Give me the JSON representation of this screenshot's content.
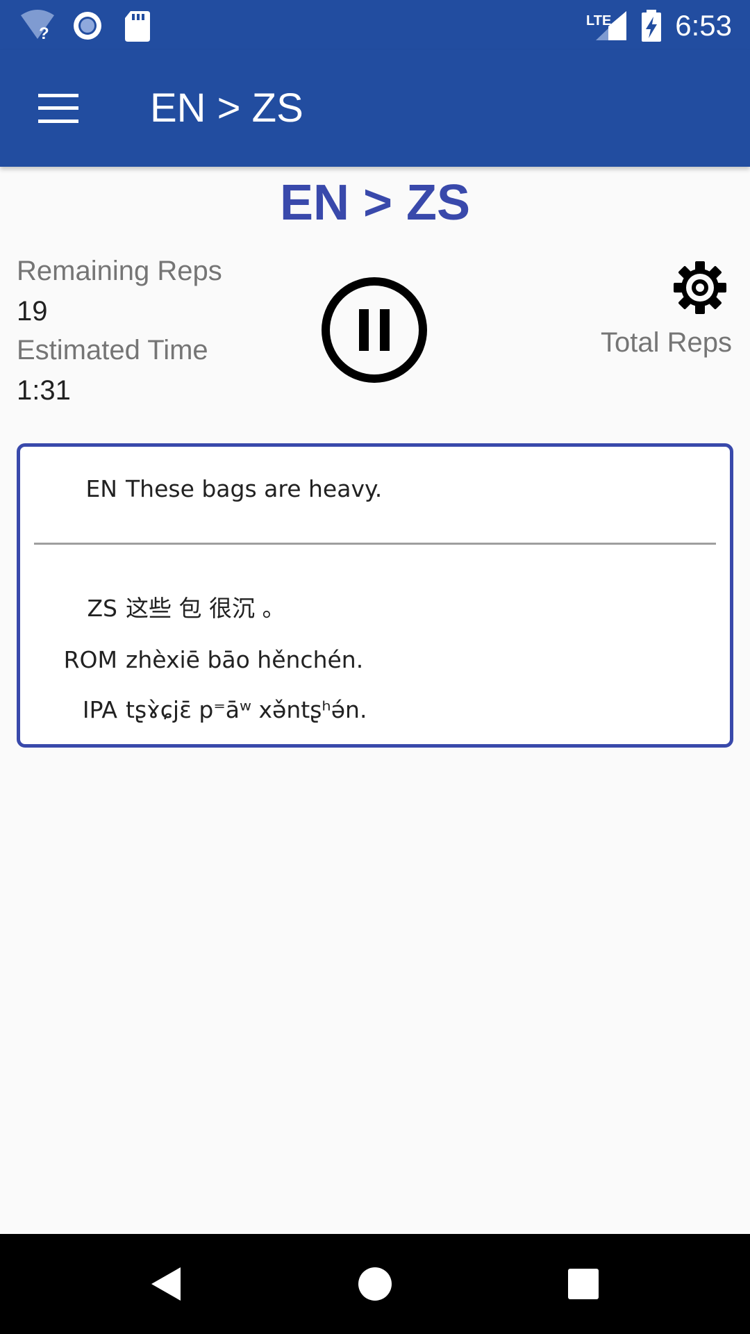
{
  "status_bar": {
    "time": "6:53",
    "network": "LTE",
    "icons": [
      "wifi-unknown-icon",
      "sync-icon",
      "sd-card-icon",
      "lte-signal-icon",
      "battery-charging-icon"
    ]
  },
  "app_bar": {
    "title": "EN > ZS",
    "menu_icon": "hamburger-menu-icon"
  },
  "heading": "EN > ZS",
  "stats": {
    "remaining_label": "Remaining Reps",
    "remaining_value": "19",
    "estimated_label": "Estimated Time",
    "estimated_value": "1:31",
    "total_label": "Total Reps"
  },
  "controls": {
    "pause_icon": "pause-circle-icon",
    "settings_icon": "gear-icon"
  },
  "phrase": {
    "source": {
      "tag": "EN",
      "text": "These bags are heavy."
    },
    "target": [
      {
        "tag": "ZS",
        "text": "这些 包 很沉 。"
      },
      {
        "tag": "ROM",
        "text": "zhèxiē bāo hěnchén."
      },
      {
        "tag": "IPA",
        "text": "tʂɤ̀ɕjɛ̄ p⁼āʷ xə̌ntʂʰə́n."
      }
    ]
  },
  "colors": {
    "primary": "#224da0",
    "accent": "#3949ab",
    "background": "#fafafa",
    "card": "#ffffff",
    "label_gray": "#757575",
    "text": "#212121",
    "nav_bar": "#000000"
  },
  "nav_bar": {
    "icons": [
      "back-icon",
      "home-icon",
      "recents-icon"
    ]
  }
}
